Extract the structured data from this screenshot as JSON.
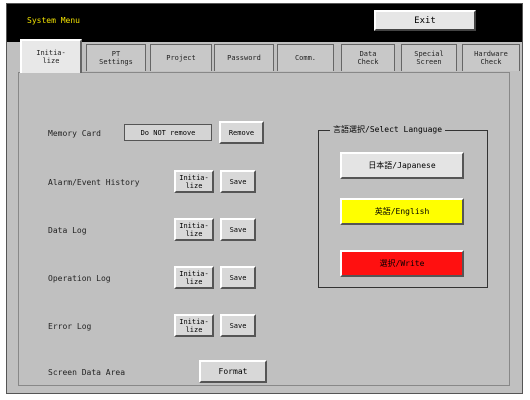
{
  "header": {
    "title": "System Menu",
    "exit_label": "Exit"
  },
  "tabs": [
    {
      "label": "Initia-\nlize",
      "active": true
    },
    {
      "label": "PT\nSettings"
    },
    {
      "label": "Project"
    },
    {
      "label": "Password"
    },
    {
      "label": "Comm."
    },
    {
      "label": "Data\nCheck"
    },
    {
      "label": "Special\nScreen"
    },
    {
      "label": "Hardware\nCheck"
    }
  ],
  "rows": {
    "memory_card": {
      "label": "Memory Card",
      "status": "Do NOT remove",
      "button": "Remove"
    },
    "alarm_event": {
      "label": "Alarm/Event History",
      "init": "Initia-\nlize",
      "save": "Save"
    },
    "data_log": {
      "label": "Data Log",
      "init": "Initia-\nlize",
      "save": "Save"
    },
    "operation_log": {
      "label": "Operation Log",
      "init": "Initia-\nlize",
      "save": "Save"
    },
    "error_log": {
      "label": "Error Log",
      "init": "Initia-\nlize",
      "save": "Save"
    },
    "screen_data": {
      "label": "Screen Data Area",
      "button": "Format"
    }
  },
  "language": {
    "legend": "言語選択/Select Language",
    "options": [
      {
        "label": "日本語/Japanese",
        "color": "#e4e4e4"
      },
      {
        "label": "英語/English",
        "color": "#ffff00"
      },
      {
        "label": "選択/Write",
        "color": "#ff1010"
      }
    ]
  }
}
